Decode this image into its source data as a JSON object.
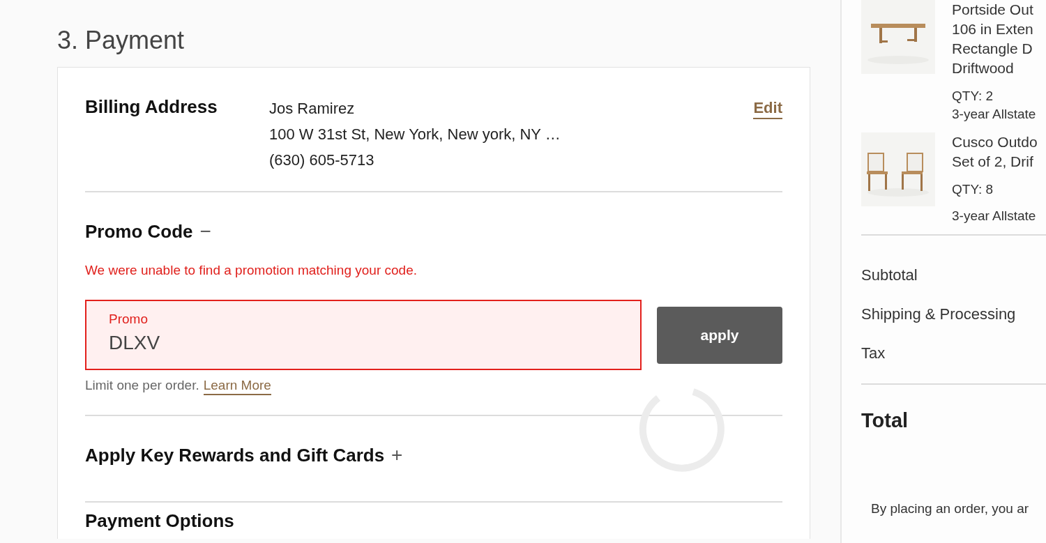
{
  "page": {
    "heading": "3. Payment"
  },
  "billing": {
    "title": "Billing Address",
    "lines": [
      "Jos Ramirez",
      "100 W 31st St, New York, New york, NY …",
      "(630) 605-5713"
    ],
    "edit": "Edit"
  },
  "promo": {
    "title": "Promo Code",
    "toggle": "−",
    "error": "We were unable to find a promotion matching your code.",
    "field": {
      "label": "Promo",
      "value": "DLXV",
      "invalid": true
    },
    "apply": "apply",
    "note": "Limit one per order.",
    "link": "Learn More"
  },
  "rewards": {
    "title": "Apply Key Rewards and Gift Cards",
    "toggle": "+"
  },
  "payment_options": {
    "title": "Payment Options"
  },
  "loading": true,
  "summary": {
    "items": [
      {
        "lines": [
          "Portside Out",
          "106 in Exten",
          "Rectangle D",
          "Driftwood"
        ],
        "qty": "QTY: 2",
        "protection": "3-year Allstate"
      },
      {
        "lines": [
          "Cusco Outdo",
          "Set of 2, Drif"
        ],
        "qty": "QTY: 8",
        "protection": "3-year Allstate"
      }
    ],
    "rows": [
      "Subtotal",
      "Shipping & Processing",
      "Tax"
    ],
    "total": "Total",
    "legal": "By placing an order, you ar"
  }
}
